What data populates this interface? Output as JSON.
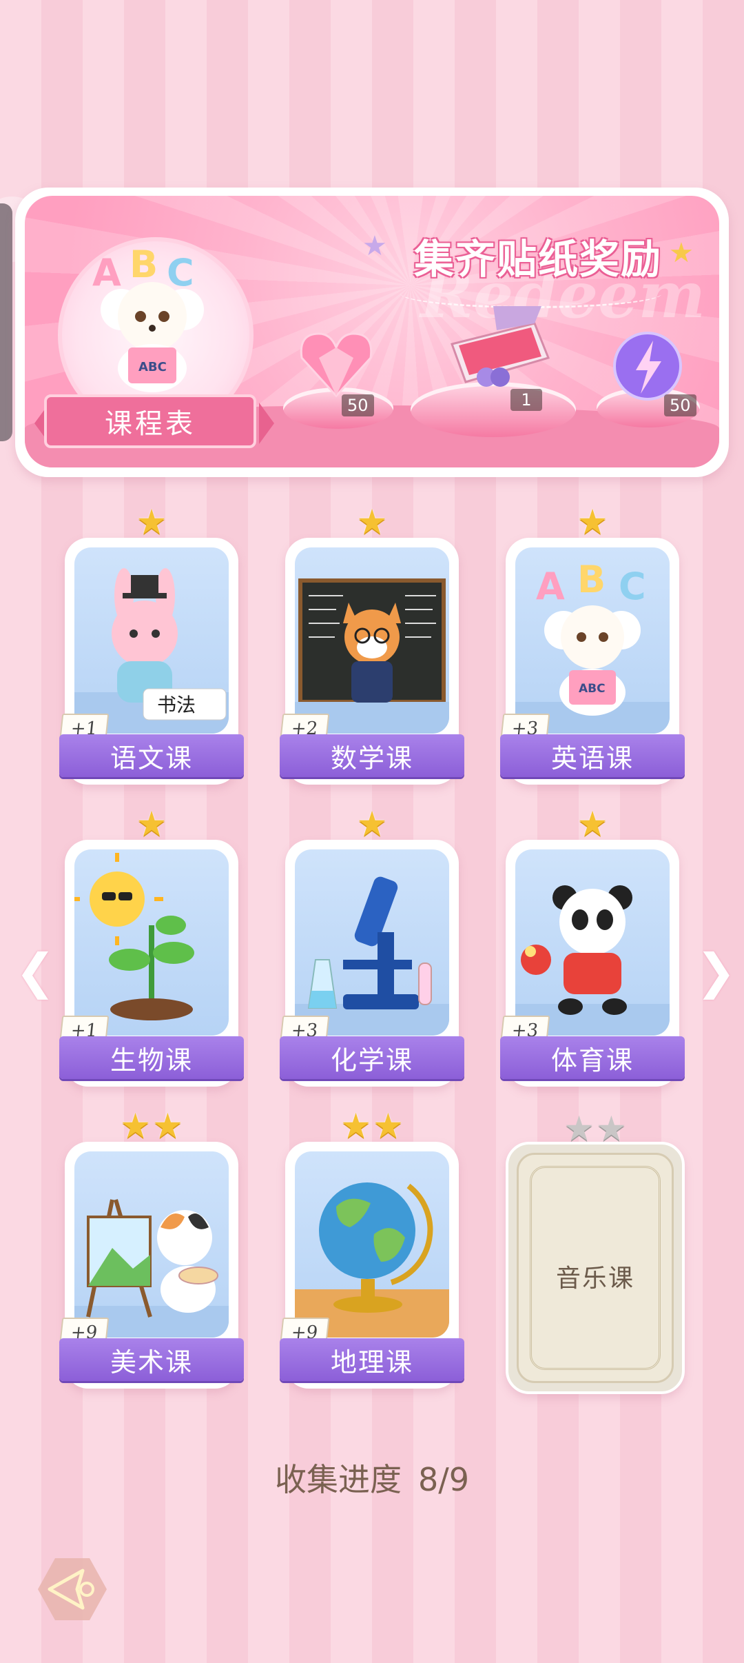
{
  "banner": {
    "title": "集齐贴纸奖励",
    "watermark": "Redeem",
    "schedule_label": "课程表",
    "rewards": [
      {
        "icon": "pink-heart-gem-icon",
        "count": "50"
      },
      {
        "icon": "gift-box-icon",
        "count": "1"
      },
      {
        "icon": "purple-energy-orb-icon",
        "count": "50"
      }
    ]
  },
  "cards": [
    {
      "name": "语文课",
      "bonus": "+1",
      "stars": 1,
      "unlocked": true,
      "art": "bunny-calligraphy"
    },
    {
      "name": "数学课",
      "bonus": "+2",
      "stars": 1,
      "unlocked": true,
      "art": "fox-teacher"
    },
    {
      "name": "英语课",
      "bonus": "+3",
      "stars": 1,
      "unlocked": true,
      "art": "poodle-abc"
    },
    {
      "name": "生物课",
      "bonus": "+1",
      "stars": 1,
      "unlocked": true,
      "art": "sun-sprout"
    },
    {
      "name": "化学课",
      "bonus": "+3",
      "stars": 1,
      "unlocked": true,
      "art": "microscope"
    },
    {
      "name": "体育课",
      "bonus": "+3",
      "stars": 1,
      "unlocked": true,
      "art": "panda-pingpong"
    },
    {
      "name": "美术课",
      "bonus": "+9",
      "stars": 2,
      "unlocked": true,
      "art": "cat-painter"
    },
    {
      "name": "地理课",
      "bonus": "+9",
      "stars": 2,
      "unlocked": true,
      "art": "globe"
    },
    {
      "name": "音乐课",
      "bonus": "",
      "stars": 2,
      "unlocked": false,
      "art": "locked"
    }
  ],
  "progress": {
    "label": "收集进度",
    "value": "8/9"
  },
  "colors": {
    "card_label": "#8c5fd8",
    "star": "#f6c132",
    "banner": "#ff9fc0"
  }
}
